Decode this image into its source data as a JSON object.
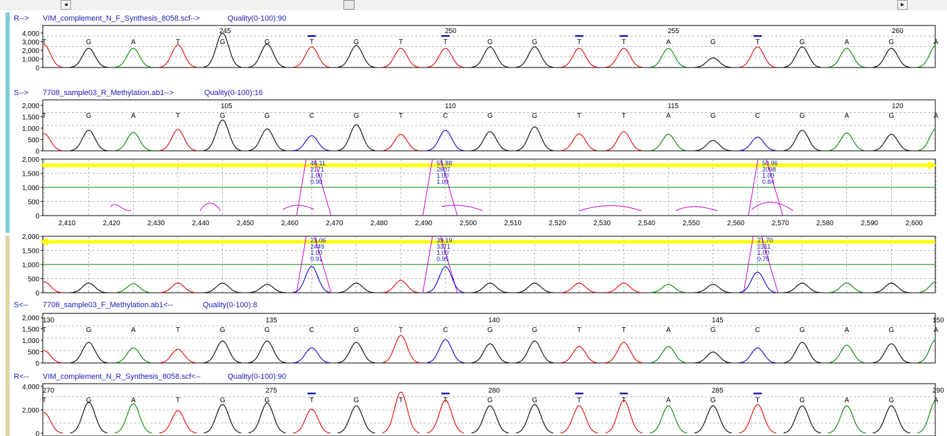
{
  "colors": {
    "A": "#008000",
    "C": "#0000cc",
    "G": "#000000",
    "T": "#e00000",
    "accent_top": "#7ccfd6",
    "accent_bottom": "#dcd8a4",
    "arrow": "#ffff00",
    "grid": "#9a9a9a",
    "heading": "#1a1ab4",
    "marker": "#cc00cc"
  },
  "scrollbar": {
    "left_arrow": "◄",
    "right_arrow": "►"
  },
  "bases": [
    "T",
    "G",
    "A",
    "T",
    "G",
    "G",
    "T",
    "G",
    "T",
    "T",
    "G",
    "G",
    "T",
    "T",
    "A",
    "G",
    "T",
    "G",
    "A",
    "G",
    "A"
  ],
  "sample_bases": [
    "T",
    "G",
    "A",
    "T",
    "G",
    "G",
    "C",
    "G",
    "T",
    "C",
    "G",
    "G",
    "T",
    "T",
    "A",
    "G",
    "C",
    "G",
    "A",
    "G",
    "A"
  ],
  "tracks": [
    {
      "id": "r1",
      "header": "R-->",
      "file": "VIM_complement_N_F_Synthesis_8058.scf-->",
      "quality": "Quality(0-100):90",
      "yticks": [
        "4,000",
        "3,000",
        "2,000",
        "1,000",
        "0"
      ],
      "positions": [
        "245",
        "250",
        "255",
        "260"
      ],
      "flagged": [
        6,
        9,
        12,
        13,
        16
      ]
    },
    {
      "id": "s1",
      "header": "S-->",
      "file": "7708_sample03_R_Methylation.ab1-->",
      "quality": "Quality(0-100):16",
      "yticks": [
        "2,000",
        "1,500",
        "1,000",
        "500",
        "0"
      ],
      "positions": [
        "105",
        "110",
        "115",
        "120"
      ]
    },
    {
      "id": "diff1",
      "yticks": [
        "2,000",
        "1,500",
        "1,000",
        "500",
        "0"
      ],
      "xticks": [
        "2,410",
        "2,420",
        "2,430",
        "2,440",
        "2,450",
        "2,460",
        "2,470",
        "2,480",
        "2,490",
        "2,500",
        "2,510",
        "2,520",
        "2,530",
        "2,540",
        "2,550",
        "2,560",
        "2,570",
        "2,580",
        "2,590",
        "2,600"
      ],
      "labels": [
        [
          "46.11",
          "2171",
          "1.00",
          "0.90"
        ],
        [
          "55.88",
          "2607",
          "1.00",
          "1.00"
        ],
        [
          "50.96",
          "2098",
          "1.00",
          "0.84"
        ]
      ]
    },
    {
      "id": "diff2",
      "yticks": [
        "2,000",
        "1,500",
        "1,000",
        "500",
        "0"
      ],
      "labels": [
        [
          "23.06",
          "2449",
          "1.00",
          "0.91"
        ],
        [
          "39.19",
          "3371",
          "1.00",
          "0.95"
        ],
        [
          "21.70",
          "2311",
          "1.00",
          "0.75"
        ]
      ]
    },
    {
      "id": "s2",
      "header": "S<--",
      "file": "7708_sample03_F_Methylation.ab1<--",
      "quality": "Quality(0-100):8",
      "yticks": [
        "2,000",
        "1,500",
        "1,000",
        "500",
        "0"
      ],
      "positions": [
        "130",
        "135",
        "140",
        "145",
        "150"
      ]
    },
    {
      "id": "r2",
      "header": "R<--",
      "file": "VIM_complement_N_R_Synthesis_8058.scf<--",
      "quality": "Quality(0-100):90",
      "yticks": [
        "4,000",
        "2,000",
        "0"
      ],
      "positions": [
        "270",
        "275",
        "280",
        "285",
        "290"
      ],
      "flagged": [
        6,
        9,
        12,
        13,
        16
      ]
    }
  ]
}
